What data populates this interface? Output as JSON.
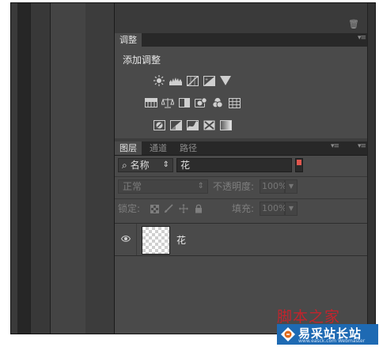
{
  "adjustments": {
    "tab_label": "调整",
    "title": "添加调整",
    "rows": [
      [
        "brightness-contrast-icon",
        "levels-icon",
        "curves-icon",
        "exposure-icon",
        "vibrance-icon"
      ],
      [
        "hue-saturation-icon",
        "color-balance-icon",
        "black-white-icon",
        "photo-filter-icon",
        "channel-mixer-icon",
        "color-lookup-icon"
      ],
      [
        "invert-icon",
        "posterize-icon",
        "threshold-icon",
        "selective-color-icon",
        "gradient-map-icon"
      ]
    ]
  },
  "layers_tabs": [
    {
      "label": "图层",
      "active": true
    },
    {
      "label": "通道",
      "active": false
    },
    {
      "label": "路径",
      "active": false
    }
  ],
  "filter": {
    "kind_label": "名称",
    "value": "花"
  },
  "blend": {
    "mode": "正常",
    "opacity_label": "不透明度:",
    "opacity_value": "100%",
    "lock_label": "锁定:",
    "fill_label": "填充:",
    "fill_value": "100%"
  },
  "layer": {
    "name": "花",
    "visible": true
  },
  "watermark": {
    "top_text": "脚本之家",
    "brand": "易采站长站",
    "url": "www.easck.com Webmaster"
  },
  "colors": {
    "filter_toggle": "#e0564e",
    "panel_bg": "#4a4a4a",
    "dark_bg": "#2f2f2f",
    "watermark_blue": "#1e6ab3"
  }
}
